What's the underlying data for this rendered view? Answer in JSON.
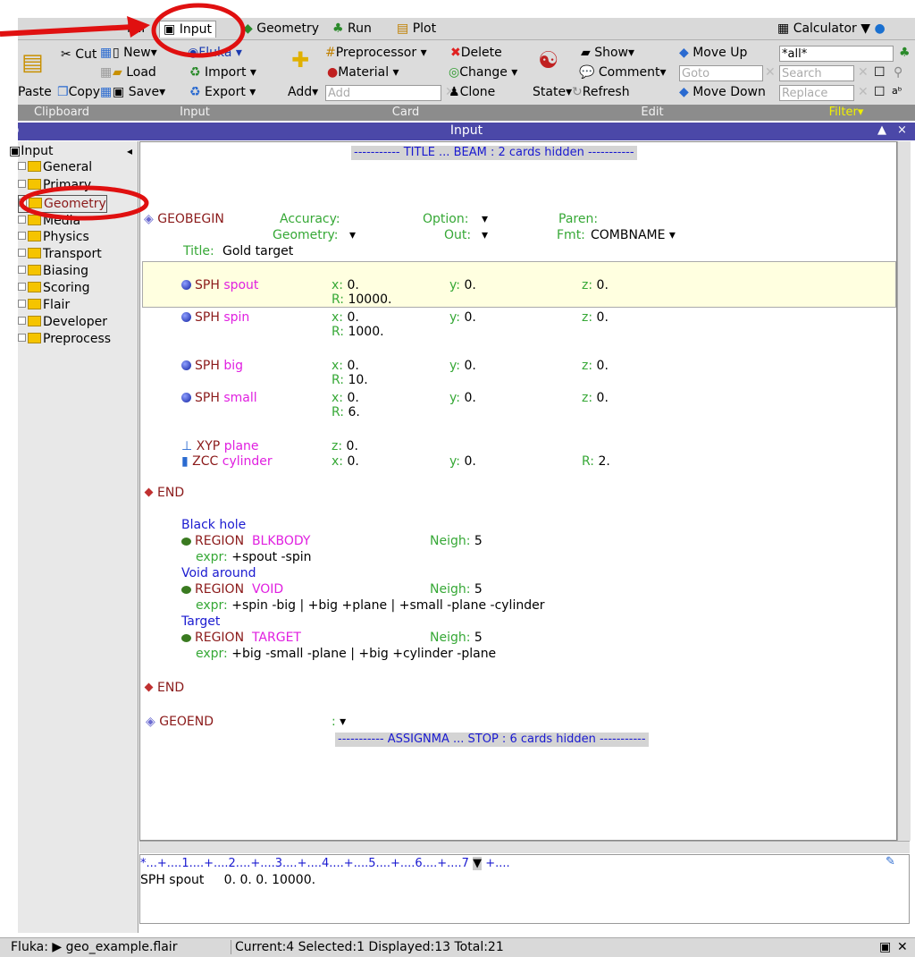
{
  "tabs": [
    {
      "label": "lair"
    },
    {
      "label": "Input"
    },
    {
      "label": "Geometry"
    },
    {
      "label": "Run"
    },
    {
      "label": "Plot"
    }
  ],
  "calculator": {
    "label": "Calculator"
  },
  "ribbon": {
    "clipboard": {
      "cut": "Cut",
      "copy": "Copy",
      "paste": "Paste"
    },
    "input": {
      "new": "New",
      "load": "Load",
      "save": "Save",
      "fluka": "Fluka",
      "import": "Import",
      "export": "Export"
    },
    "card": {
      "preprocessor": "Preprocessor",
      "material": "Material",
      "add": "Add",
      "add_placeholder": "Add",
      "delete": "Delete",
      "change": "Change",
      "clone": "Clone"
    },
    "edit": {
      "show": "Show",
      "comment": "Comment",
      "state": "State",
      "refresh": "Refresh",
      "move_up": "Move Up",
      "move_down": "Move Down",
      "goto_placeholder": "Goto"
    },
    "filter": {
      "value": "*all*",
      "search_placeholder": "Search",
      "replace_placeholder": "Replace"
    }
  },
  "groups": [
    "Clipboard",
    "Input",
    "Card",
    "Edit",
    "Filter"
  ],
  "panel_title": "Input",
  "tree": {
    "root": "Input",
    "items": [
      "General",
      "Primary",
      "Geometry",
      "Media",
      "Physics",
      "Transport",
      "Biasing",
      "Scoring",
      "Flair",
      "Developer",
      "Preprocess"
    ]
  },
  "editor": {
    "hidden_top": "----------- TITLE ... BEAM : 2 cards hidden -----------",
    "geobegin": {
      "kw": "GEOBEGIN",
      "accuracy": "Accuracy:",
      "option": "Option:",
      "paren": "Paren:",
      "geometry": "Geometry:",
      "out": "Out:",
      "fmt": "Fmt:",
      "fmt_val": "COMBNAME",
      "title_label": "Title:",
      "title_val": "Gold target"
    },
    "bodies": [
      {
        "type": "SPH",
        "name": "spout",
        "x": "0.",
        "y": "0.",
        "z": "0.",
        "R": "10000."
      },
      {
        "type": "SPH",
        "name": "spin",
        "x": "0.",
        "y": "0.",
        "z": "0.",
        "R": "1000."
      },
      {
        "type": "SPH",
        "name": "big",
        "x": "0.",
        "y": "0.",
        "z": "0.",
        "R": "10."
      },
      {
        "type": "SPH",
        "name": "small",
        "x": "0.",
        "y": "0.",
        "z": "0.",
        "R": "6."
      }
    ],
    "xyp": {
      "type": "XYP",
      "name": "plane",
      "z": "0."
    },
    "zcc": {
      "type": "ZCC",
      "name": "cylinder",
      "x": "0.",
      "y": "0.",
      "R": "2."
    },
    "end": "END",
    "regions": [
      {
        "comment": "Black hole",
        "name": "BLKBODY",
        "neigh": "5",
        "expr": "+spout -spin"
      },
      {
        "comment": "Void around",
        "name": "VOID",
        "neigh": "5",
        "expr": "+spin -big | +big +plane | +small -plane -cylinder"
      },
      {
        "comment": "Target",
        "name": "TARGET",
        "neigh": "5",
        "expr": "+big -small -plane | +big +cylinder -plane"
      }
    ],
    "region_kw": "REGION",
    "geoend": "GEOEND",
    "hidden_bottom": "----------- ASSIGNMA ... STOP : 6 cards hidden -----------"
  },
  "bottom": {
    "ruler": "*...+....1....+....2....+....3....+....4....+....5....+....6....+....7",
    "ruler_tail": "+....",
    "text": "SPH spout     0. 0. 0. 10000."
  },
  "status": {
    "fluka": "Fluka: ▶ geo_example.flair",
    "counts": "Current:4 Selected:1 Displayed:13 Total:21"
  },
  "colors": {
    "title_bar": "#4b48a8",
    "highlight_row": "#ffffe0",
    "annotation": "#e01010"
  }
}
